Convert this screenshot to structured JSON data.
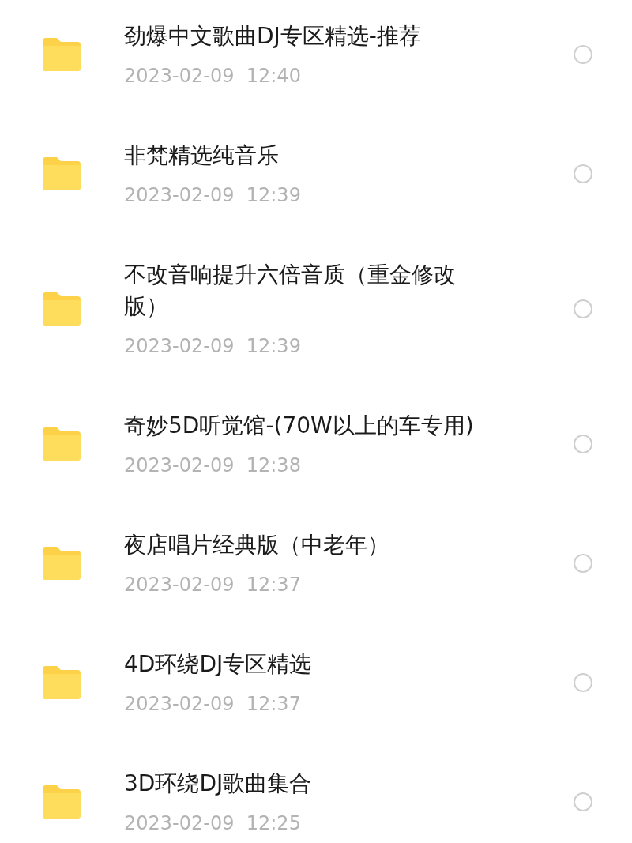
{
  "folders": [
    {
      "name": "劲爆中文歌曲DJ专区精选-推荐",
      "date": "2023-02-09  12:40",
      "selected": false
    },
    {
      "name": "非梵精选纯音乐",
      "date": "2023-02-09  12:39",
      "selected": false
    },
    {
      "name": "不改音响提升六倍音质（重金修改版）",
      "date": "2023-02-09  12:39",
      "selected": false
    },
    {
      "name": "奇妙5D听觉馆-(70W以上的车专用)",
      "date": "2023-02-09  12:38",
      "selected": false
    },
    {
      "name": "夜店唱片经典版（中老年）",
      "date": "2023-02-09  12:37",
      "selected": false
    },
    {
      "name": "4D环绕DJ专区精选",
      "date": "2023-02-09  12:37",
      "selected": false
    },
    {
      "name": "3D环绕DJ歌曲集合",
      "date": "2023-02-09  12:25",
      "selected": false
    }
  ]
}
